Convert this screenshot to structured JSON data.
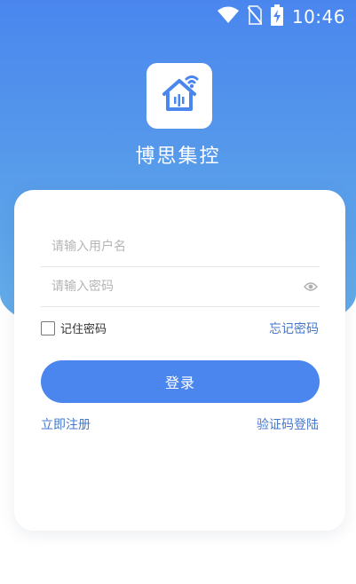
{
  "status_bar": {
    "time": "10:46",
    "icons": [
      "wifi-icon",
      "no-sim-icon",
      "battery-charging-icon"
    ]
  },
  "app": {
    "name": "博思集控",
    "logo_icon": "smart-home-logo-icon"
  },
  "login_form": {
    "username_placeholder": "请输入用户名",
    "password_placeholder": "请输入密码",
    "password_toggle_icon": "eye-icon",
    "remember_label": "记住密码",
    "remember_checked": false,
    "forgot_label": "忘记密码",
    "login_button": "登录",
    "register_link": "立即注册",
    "code_login_link": "验证码登陆"
  },
  "colors": {
    "primary": "#4a86ee",
    "link": "#4477cc",
    "header_gradient_end": "#66b0e8"
  }
}
